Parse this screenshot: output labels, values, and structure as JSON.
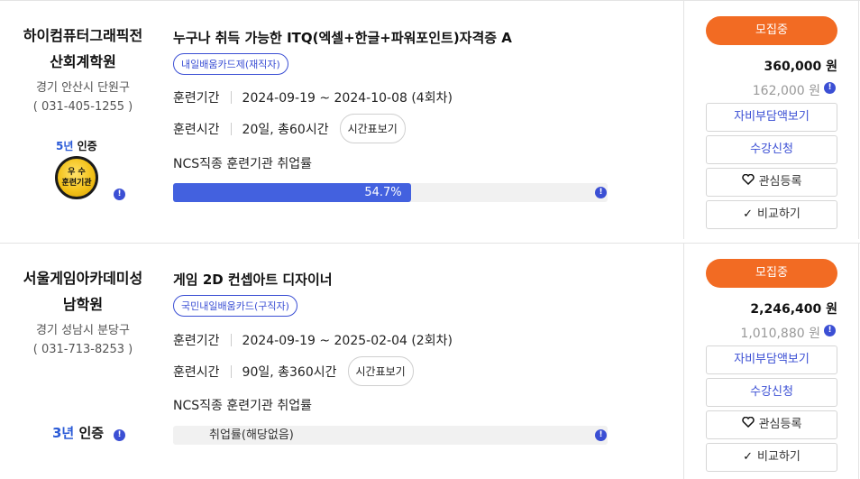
{
  "courses": [
    {
      "institution": {
        "name_line1": "하이컴퓨터그래픽전",
        "name_line2": "산회계학원",
        "address": "경기 안산시 단원구",
        "phone": "( 031-405-1255 )"
      },
      "certification": {
        "years": "5년",
        "label": "인증",
        "medal_line1": "우 수",
        "medal_line2": "훈련기관"
      },
      "title": "누구나 취득 가능한 ITQ(엑셀+한글+파워포인트)자격증 A",
      "badge": "내일배움카드제(재직자)",
      "period_label": "훈련기간",
      "period_value": "2024-09-19 ~ 2024-10-08 (4회차)",
      "hours_label": "훈련시간",
      "hours_value": "20일, 총60시간",
      "schedule_button": "시간표보기",
      "employment_label": "NCS직종 훈련기관 취업률",
      "employment_rate": 54.7,
      "employment_rate_text": "54.7%",
      "employment_note": "",
      "status": "모집중",
      "price": "360,000 원",
      "self_pay": "162,000 원",
      "buttons": {
        "self_pay": "자비부담액보기",
        "apply": "수강신청",
        "favorite": "관심등록",
        "compare": "비교하기"
      }
    },
    {
      "institution": {
        "name_line1": "서울게임아카데미성",
        "name_line2": "남학원",
        "address": "경기 성남시 분당구",
        "phone": "( 031-713-8253 )"
      },
      "certification": {
        "years": "3년",
        "label": "인증"
      },
      "title": "게임 2D 컨셉아트 디자이너",
      "badge": "국민내일배움카드(구직자)",
      "period_label": "훈련기간",
      "period_value": "2024-09-19 ~ 2025-02-04 (2회차)",
      "hours_label": "훈련시간",
      "hours_value": "90일, 총360시간",
      "schedule_button": "시간표보기",
      "employment_label": "NCS직종 훈련기관 취업률",
      "employment_note": "취업률(해당없음)",
      "status": "모집중",
      "price": "2,246,400 원",
      "self_pay": "1,010,880 원",
      "buttons": {
        "self_pay": "자비부담액보기",
        "apply": "수강신청",
        "favorite": "관심등록",
        "compare": "비교하기"
      }
    }
  ],
  "icons": {
    "info": "info-icon",
    "heart": "heart-icon",
    "check": "check-icon"
  },
  "colors": {
    "accent": "#f26b23",
    "primary": "#4361df",
    "badge": "#3b4fd4"
  }
}
